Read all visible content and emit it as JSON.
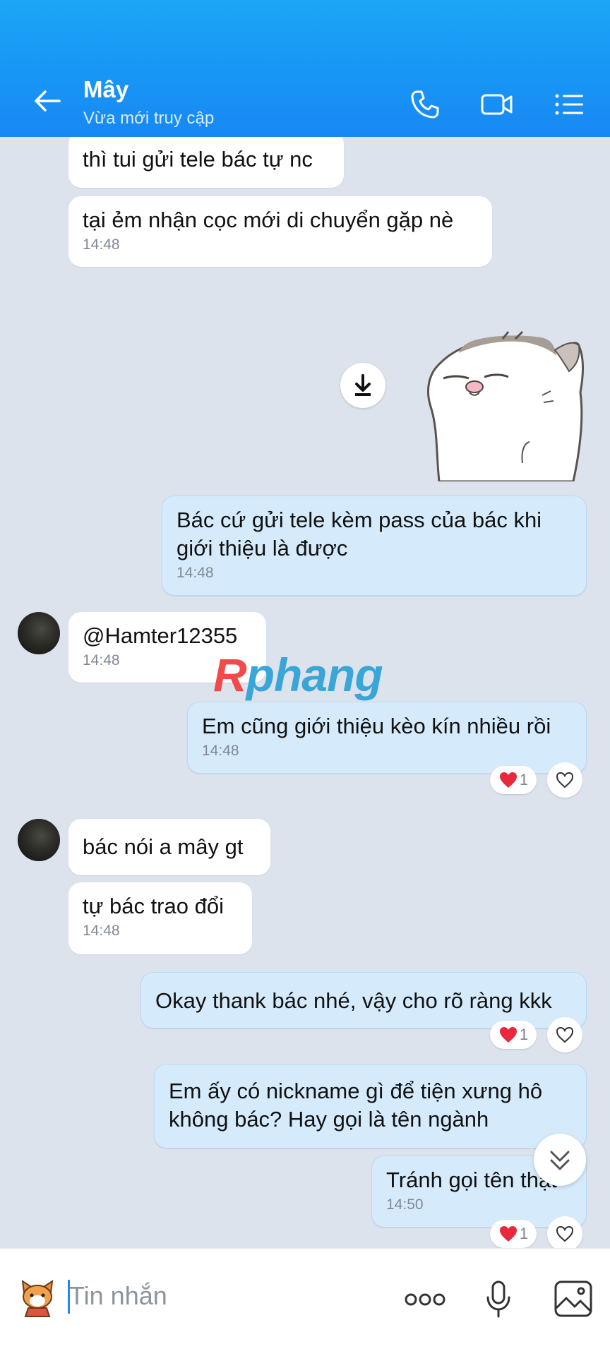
{
  "header": {
    "contact_name": "Mây",
    "status": "Vừa mới truy cập"
  },
  "messages": [
    {
      "direction": "in",
      "text": "thì tui gửi tele bác tự nc",
      "time": ""
    },
    {
      "direction": "in",
      "text": "tại ẻm nhận cọc mới di chuyển gặp nè",
      "time": "14:48"
    },
    {
      "direction": "in",
      "type": "sticker",
      "sticker": "white cat sticker"
    },
    {
      "direction": "out",
      "text": "Bác cứ gửi tele kèm pass của bác khi giới thiệu là được",
      "time": "14:48"
    },
    {
      "direction": "in",
      "text": "@Hamter12355",
      "time": "14:48"
    },
    {
      "direction": "out",
      "text": "Em cũng giới thiệu kèo kín nhiều rồi",
      "time": "14:48",
      "reaction_count": "1"
    },
    {
      "direction": "in",
      "text": "bác nói a mây gt",
      "time": ""
    },
    {
      "direction": "in",
      "text": "tự bác trao đổi",
      "time": "14:48"
    },
    {
      "direction": "out",
      "text": "Okay thank bác nhé, vậy cho rõ ràng kkk",
      "time": "",
      "reaction_count": "1"
    },
    {
      "direction": "out",
      "text": "Em ấy có nickname gì để tiện xưng hô không bác? Hay gọi là tên ngành",
      "time": ""
    },
    {
      "direction": "out",
      "text": "Tránh gọi tên thật",
      "time": "14:50",
      "reaction_count": "1"
    }
  ],
  "watermark": {
    "part1": "R",
    "part2": "phang"
  },
  "composer": {
    "placeholder": "Tin nhắn"
  },
  "colors": {
    "header": "#1788f3",
    "incoming": "#ffffff",
    "outgoing": "#d5ebfc",
    "heart": "#e8283c"
  }
}
